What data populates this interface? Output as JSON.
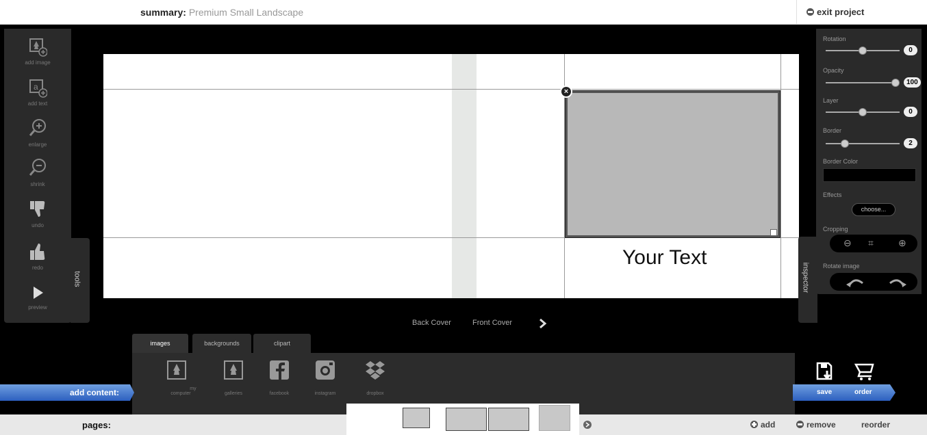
{
  "header": {
    "summary_label": "summary:",
    "summary_value": "Premium Small Landscape",
    "exit_label": "exit project"
  },
  "tools": {
    "tab_label": "tools",
    "items": [
      {
        "label": "add image",
        "icon": "add-image-icon"
      },
      {
        "label": "add text",
        "icon": "add-text-icon"
      },
      {
        "label": "enlarge",
        "icon": "zoom-in-icon"
      },
      {
        "label": "shrink",
        "icon": "zoom-out-icon"
      },
      {
        "label": "undo",
        "icon": "thumbs-down-icon"
      },
      {
        "label": "redo",
        "icon": "thumbs-up-icon"
      },
      {
        "label": "preview",
        "icon": "play-icon"
      }
    ]
  },
  "canvas": {
    "text": "Your Text"
  },
  "nav": {
    "back": "Back Cover",
    "front": "Front Cover"
  },
  "inspector": {
    "tab_label": "inspector",
    "rotation_label": "Rotation",
    "rotation": "0",
    "opacity_label": "Opacity",
    "opacity": "100",
    "layer_label": "Layer",
    "layer": "0",
    "border_label": "Border",
    "border": "2",
    "border_color_label": "Border Color",
    "effects_label": "Effects",
    "effects_button": "choose...",
    "cropping_label": "Cropping",
    "rotate_label": "Rotate image"
  },
  "library": {
    "tabs": [
      "images",
      "backgrounds",
      "clipart"
    ],
    "sources": [
      "my computer",
      "galleries",
      "facebook",
      "instagram",
      "dropbox"
    ]
  },
  "footer": {
    "add_content": "add content:",
    "save": "save",
    "order": "order",
    "pages_label": "pages:",
    "add": "add",
    "remove": "remove",
    "reorder": "reorder"
  },
  "colors": {
    "accent_blue": "#3b6fd0",
    "dark_panel": "#2a2a2a",
    "photo_placeholder": "#b8b8b8"
  }
}
